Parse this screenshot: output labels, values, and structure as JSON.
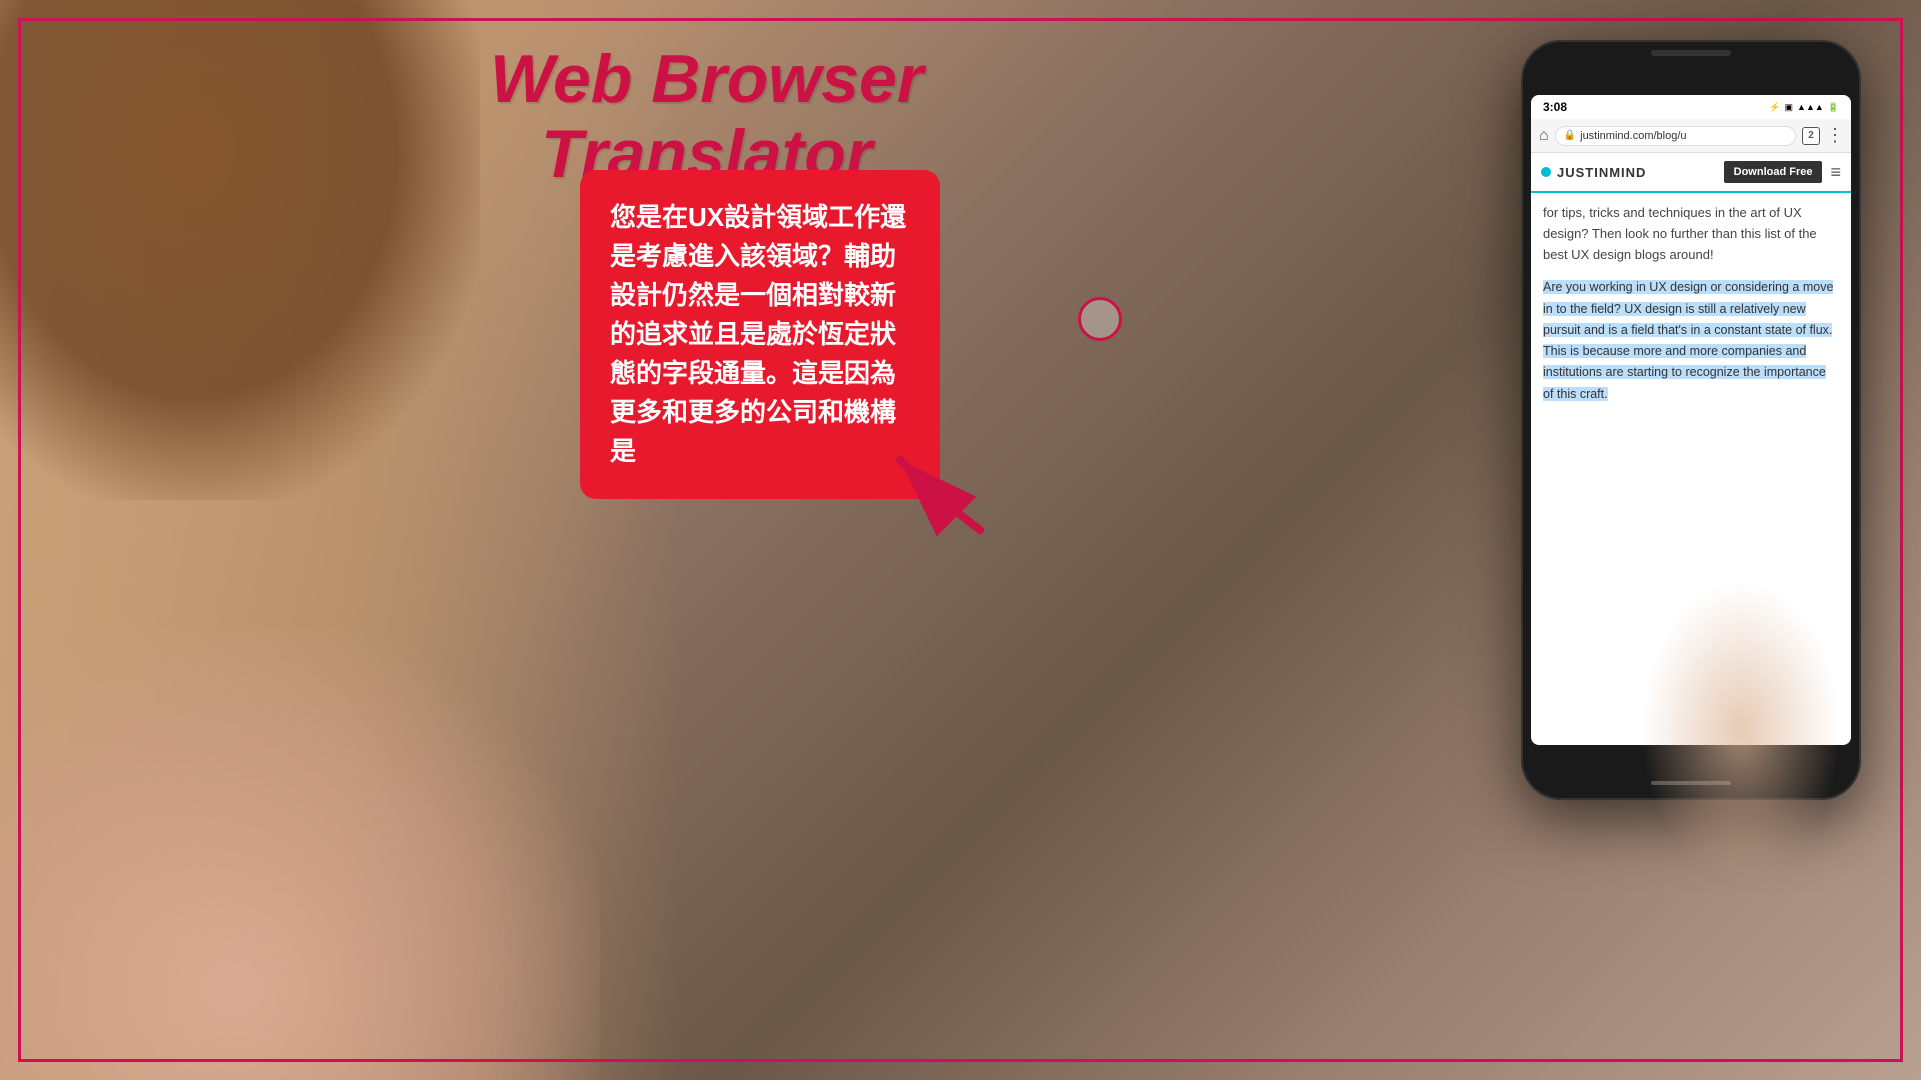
{
  "title": {
    "line1": "Web Browser",
    "line2": "Translator"
  },
  "phone": {
    "status": {
      "time": "3:08",
      "signal_icon": "📶",
      "wifi_icon": "WiFi",
      "battery": "80"
    },
    "browser": {
      "url": "justinmind.com/blog/u",
      "tab_count": "2"
    },
    "nav": {
      "logo": "JUSTINMIND",
      "download_btn": "Download Free",
      "teal_dot": true
    },
    "content": {
      "intro": "for tips, tricks and techniques in the art of UX design? Then look no further than this list of the best UX design blogs around!",
      "highlighted_paragraph": "Are you working in UX design or considering a move in to the field? UX design is still a relatively new pursuit and is a field that's in a constant state of flux. This is because more and more companies and institutions are starting to recognize the importance of this craft."
    }
  },
  "translation_bubble": {
    "text": "您是在UX設計領域工作還是考慮進入該領域？輔助設計仍然是一個相對較新的追求並且是處於恆定狀態的字段通量。這是因為更多和更多的公司和機構是"
  },
  "arrow": {
    "color": "#cc1144",
    "direction": "pointing to bubble"
  },
  "tap_circle": {
    "visible": true,
    "color": "#cc1144"
  },
  "detected_texts": {
    "still_relatively_new": "still a relatively new pursuit",
    "and_is": "and is",
    "that_in_constant": "that's in a constant state",
    "because_more_and": "because more and",
    "starting_to": "starting to"
  }
}
